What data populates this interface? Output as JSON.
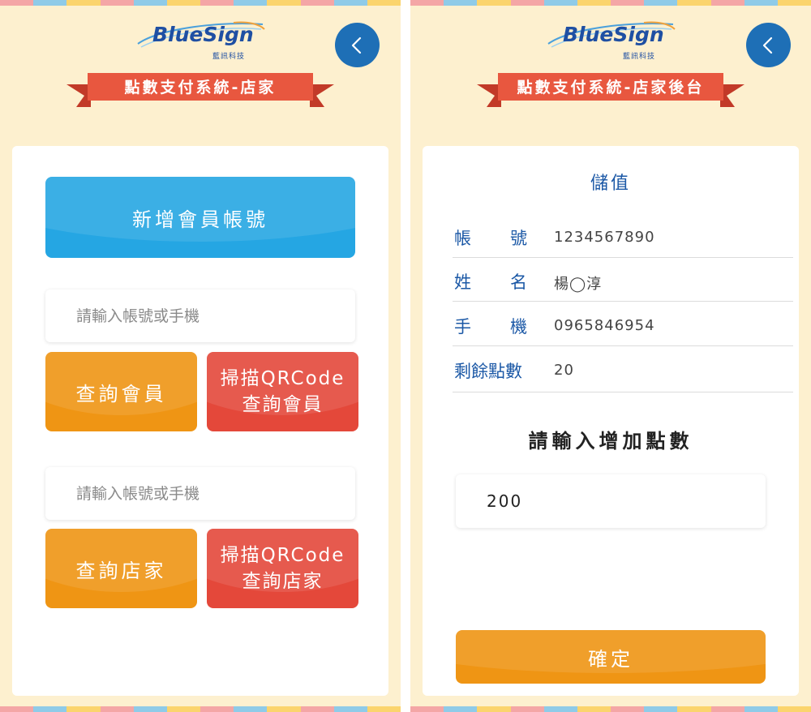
{
  "colors": {
    "background": "#fdf0cf",
    "accent_blue": "#25a6e3",
    "accent_orange": "#ef9514",
    "accent_red": "#e4483a",
    "banner": "#e8573f",
    "nav_blue": "#1e6fb6",
    "label_blue": "#1b58a6",
    "stripe": [
      "#f4a6a6",
      "#8fcbe8",
      "#fbd46d",
      "#f4a6a6",
      "#8fcbe8",
      "#fbd46d"
    ]
  },
  "left": {
    "logo": {
      "text": "BlueSign",
      "sub": "藍訊科技"
    },
    "back_icon": "chevron-left-icon",
    "banner_title": "點數支付系統-店家",
    "add_member_label": "新增會員帳號",
    "member_search": {
      "placeholder": "請輸入帳號或手機",
      "value": "",
      "query_label": "查詢會員",
      "scan_label_line1": "掃描QRCode",
      "scan_label_line2": "查詢會員"
    },
    "store_search": {
      "placeholder": "請輸入帳號或手機",
      "value": "",
      "query_label": "查詢店家",
      "scan_label_line1": "掃描QRCode",
      "scan_label_line2": "查詢店家"
    }
  },
  "right": {
    "logo": {
      "text": "BlueSign",
      "sub": "藍訊科技"
    },
    "back_icon": "chevron-left-icon",
    "banner_title": "點數支付系統-店家後台",
    "section_title": "儲值",
    "rows": [
      {
        "label_a": "帳",
        "label_b": "號",
        "value": "1234567890"
      },
      {
        "label_a": "姓",
        "label_b": "名",
        "value": "楊◯淳"
      },
      {
        "label_a": "手",
        "label_b": "機",
        "value": "0965846954"
      },
      {
        "label_a": "剩餘點數",
        "label_b": "",
        "value": "20"
      }
    ],
    "points_prompt": "請輸入增加點數",
    "points_input_value": "200",
    "confirm_label": "確定"
  }
}
